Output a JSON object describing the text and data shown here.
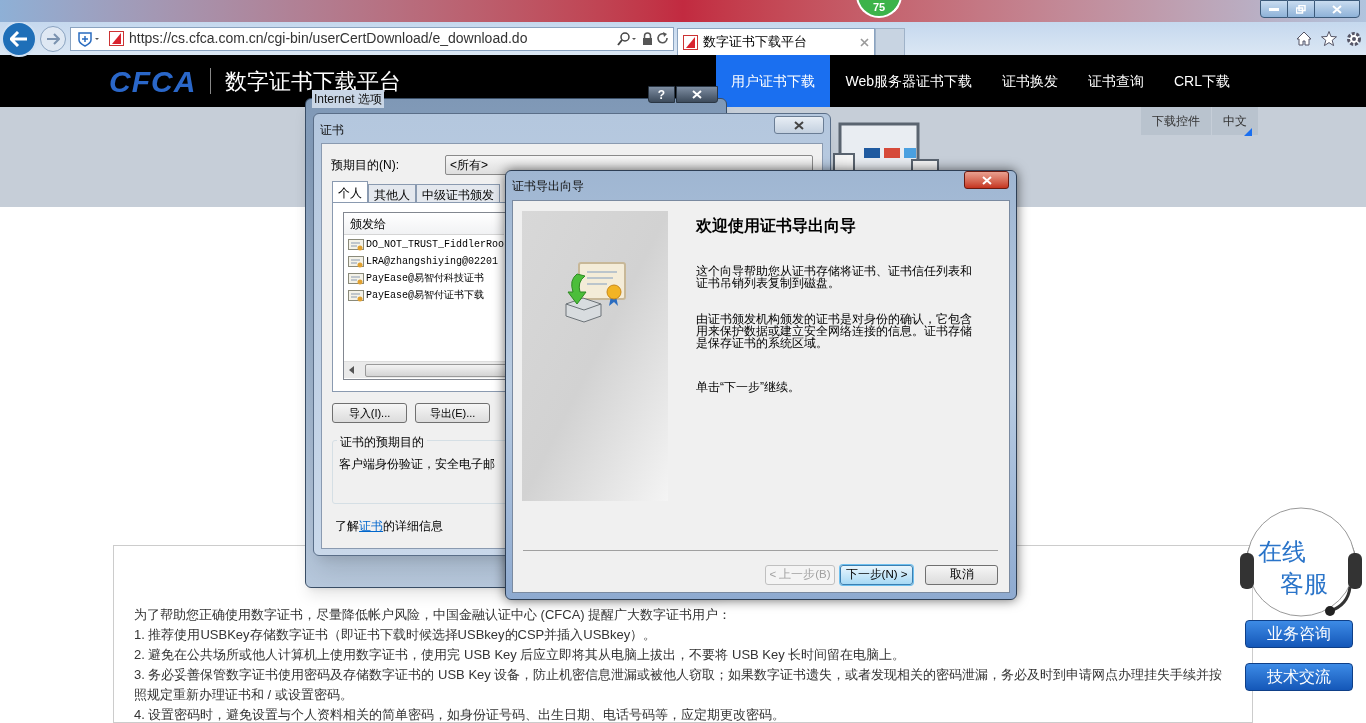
{
  "browser": {
    "badge": "75",
    "url": "https://cs.cfca.com.cn/cgi-bin/userCertDownload/e_download.do",
    "tab_title": "数字证书下载平台"
  },
  "site": {
    "logo": "CFCA",
    "title": "数字证书下载平台",
    "nav": [
      {
        "label": "用户证书下载",
        "selected": true
      },
      {
        "label": "Web服务器证书下载",
        "selected": false
      },
      {
        "label": "证书换发",
        "selected": false
      },
      {
        "label": "证书查询",
        "selected": false
      },
      {
        "label": "CRL下载",
        "selected": false
      }
    ],
    "tools": [
      "下载控件",
      "中文"
    ]
  },
  "internet_options_dialog": {
    "title": "Internet 选项",
    "help_label": "?"
  },
  "certificates_dialog": {
    "title": "证书",
    "purpose_label": "预期目的(N):",
    "purpose_value": "<所有>",
    "tabs": [
      {
        "label": "个人",
        "selected": true
      },
      {
        "label": "其他人",
        "selected": false
      },
      {
        "label": "中级证书颁发",
        "selected": false
      }
    ],
    "column": "颁发给",
    "rows": [
      "DO_NOT_TRUST_FiddlerRoo",
      "LRA@zhangshiying@02201",
      "PayEase@易智付科技证书",
      "PayEase@易智付证书下载"
    ],
    "buttons": [
      "导入(I)...",
      "导出(E)..."
    ],
    "group_title": "证书的预期目的",
    "group_text": "客户端身份验证，安全电子邮",
    "info": {
      "before": "了解",
      "link": "证书",
      "after": "的详细信息"
    }
  },
  "export_wizard": {
    "title": "证书导出向导",
    "heading": "欢迎使用证书导出向导",
    "paragraphs": [
      "这个向导帮助您从证书存储将证书、证书信任列表和证书吊销列表复制到磁盘。",
      "由证书颁发机构颁发的证书是对身份的确认，它包含用来保护数据或建立安全网络连接的信息。证书存储是保存证书的系统区域。",
      "单击“下一步”继续。"
    ],
    "buttons": [
      {
        "label": "< 上一步(B)",
        "disabled": true,
        "default": false
      },
      {
        "label": "下一步(N) >",
        "disabled": false,
        "default": true
      },
      {
        "label": "取消",
        "disabled": false,
        "default": false
      }
    ]
  },
  "notice": {
    "intro": "为了帮助您正确使用数字证书，尽量降低帐户风险，中国金融认证中心 (CFCA) 提醒广大数字证书用户：",
    "items": [
      "1. 推荐使用USBKey存储数字证书（即证书下载时候选择USBkey的CSP并插入USBkey）。",
      "2. 避免在公共场所或他人计算机上使用数字证书，使用完 USB Key 后应立即将其从电脑上拔出，不要将 USB Key 长时间留在电脑上。",
      "3. 务必妥善保管数字证书使用密码及存储数字证书的 USB Key 设备，防止机密信息泄漏或被他人窃取；如果数字证书遗失，或者发现相关的密码泄漏，务必及时到申请网点办理挂失手续并按照规定重新办理证书和 / 或设置密码。",
      "4. 设置密码时，避免设置与个人资料相关的简单密码，如身份证号码、出生日期、电话号码等，应定期更改密码。"
    ]
  },
  "support": {
    "label_lines": [
      "在线",
      "客服"
    ],
    "buttons": [
      "业务咨询",
      "技术交流"
    ]
  }
}
